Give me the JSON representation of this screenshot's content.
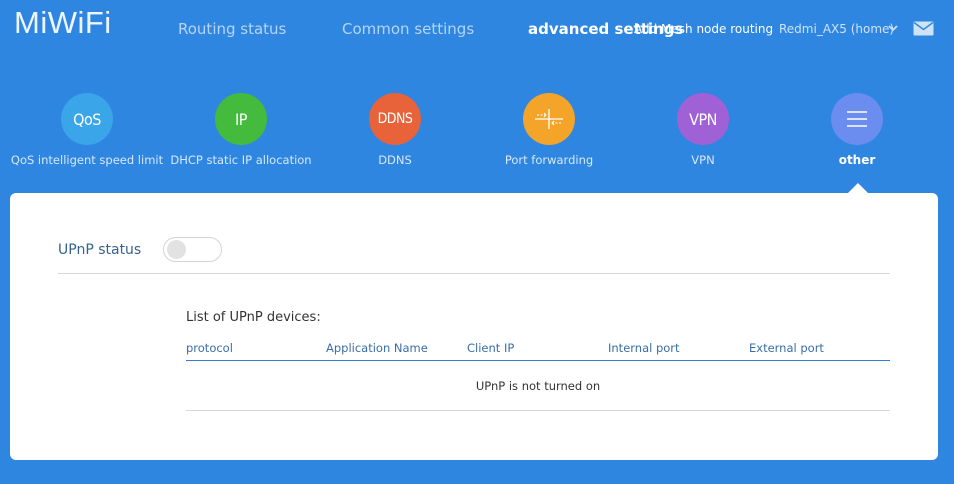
{
  "header": {
    "logo": "MiWiFi",
    "nav": [
      {
        "label": "Routing status"
      },
      {
        "label": "Common settings"
      },
      {
        "label": "advanced settings"
      }
    ],
    "mesh_link": "Add Mesh node routing",
    "router_name": "Redmi_AX5 (home)",
    "icons": {
      "dropdown": "chevron-down-icon",
      "mail": "mail-icon"
    }
  },
  "features": [
    {
      "icon_text": "QoS",
      "label": "QoS intelligent speed limit",
      "color": "#3aa5e8"
    },
    {
      "icon_text": "IP",
      "label": "DHCP static IP allocation",
      "color": "#44bb3d"
    },
    {
      "icon_text": "DDNS",
      "label": "DDNS",
      "color": "#e8623a"
    },
    {
      "icon_text": "",
      "icon": "port-forwarding-icon",
      "label": "Port forwarding",
      "color": "#f4a529"
    },
    {
      "icon_text": "VPN",
      "label": "VPN",
      "color": "#a061d6"
    },
    {
      "icon_text": "",
      "icon": "menu-icon",
      "label": "other",
      "color": "#6b8df0"
    }
  ],
  "upnp": {
    "status_label": "UPnP status",
    "enabled": false,
    "list_title": "List of UPnP devices:",
    "columns": [
      "protocol",
      "Application Name",
      "Client IP",
      "Internal port",
      "External port"
    ],
    "empty_message": "UPnP is not turned on"
  },
  "colors": {
    "background": "#2e86e0",
    "card": "#ffffff",
    "accent_line": "#2e7fd0"
  }
}
